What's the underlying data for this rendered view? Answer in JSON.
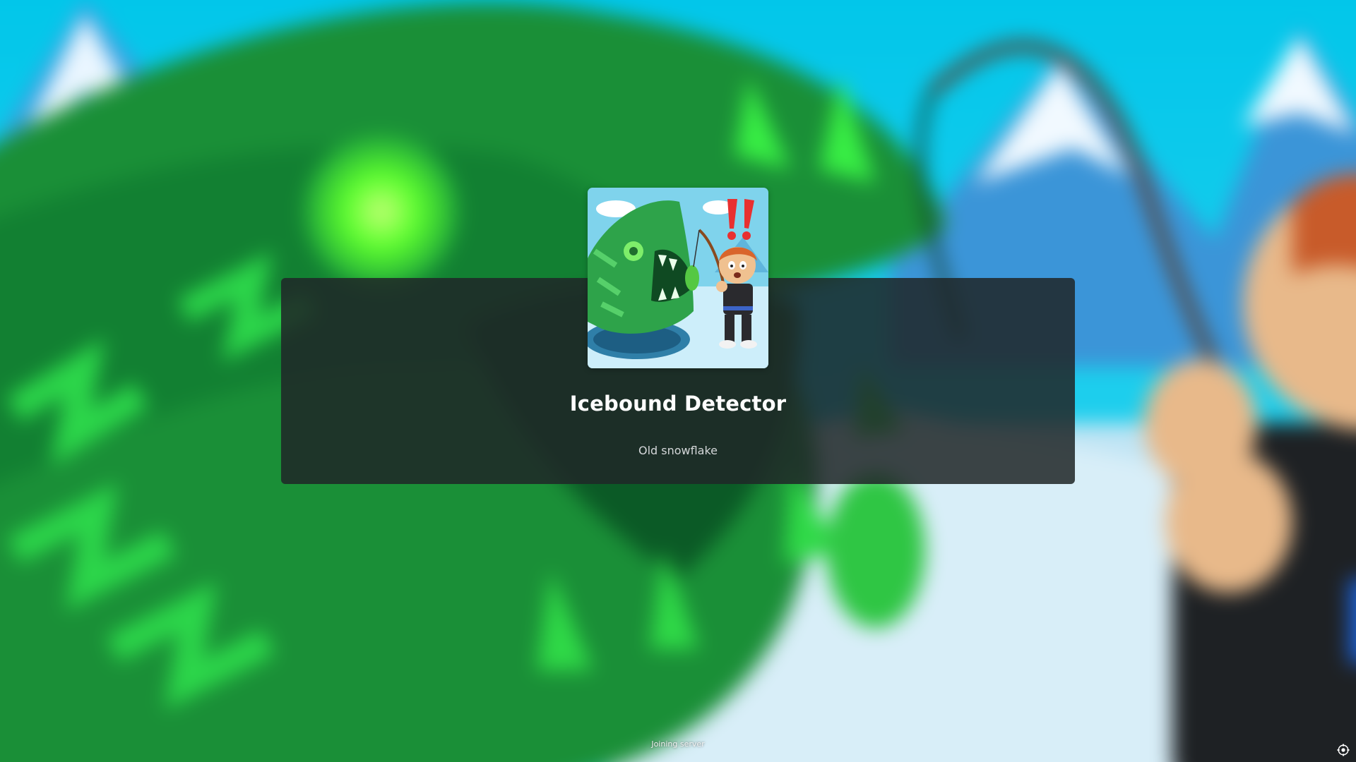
{
  "game": {
    "title": "Icebound Detector",
    "creator": "Old snowflake"
  },
  "status": {
    "text": "Joining server"
  },
  "icons": {
    "settings": "settings-icon",
    "thumbnail": "game-thumbnail"
  },
  "colors": {
    "panel": "#202628",
    "sky": "#00c8e8",
    "fish_green": "#1f9a3a",
    "eye_glow": "#55ff33",
    "title_text": "#ffffff",
    "creator_text": "#d4d7d9"
  }
}
